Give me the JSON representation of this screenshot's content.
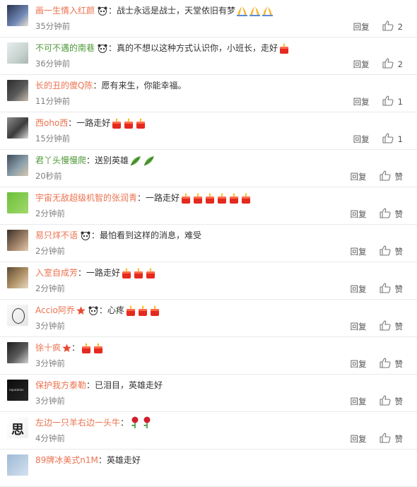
{
  "comments": [
    {
      "user": "画一生情入红颜",
      "text": "：战士永远是战士，天堂依旧有梦",
      "emoji": [
        "pray",
        "pray",
        "pray"
      ],
      "time": "35分钟前",
      "reply": "回复",
      "likes": "2",
      "panda": true
    },
    {
      "user": "不可不遇的南巷",
      "text": "：真的不想以这种方式认识你，小班长，走好",
      "emoji": [
        "candle"
      ],
      "time": "36分钟前",
      "reply": "回复",
      "likes": "2",
      "panda": true
    },
    {
      "user": "长的丑的傻Q陈",
      "text": "：愿有来生，你能幸福。",
      "emoji": [],
      "time": "11分钟前",
      "reply": "回复",
      "likes": "1",
      "panda": false
    },
    {
      "user": "西oho西",
      "text": "：一路走好",
      "emoji": [
        "candle",
        "candle",
        "candle"
      ],
      "time": "15分钟前",
      "reply": "回复",
      "likes": "1",
      "panda": false
    },
    {
      "user": "君丫头慢慢爬",
      "text": "：送别英雄",
      "emoji": [
        "leaf",
        "leaf"
      ],
      "time": "20秒前",
      "reply": "回复",
      "likes": "赞",
      "panda": false
    },
    {
      "user": "宇宙无敌超级机智的张润青",
      "text": "：一路走好",
      "emoji": [
        "candle",
        "candle",
        "candle",
        "candle",
        "candle",
        "candle"
      ],
      "time": "2分钟前",
      "reply": "回复",
      "likes": "赞",
      "panda": false
    },
    {
      "user": "易只烊不语",
      "text": "：最怕看到这样的消息，难受",
      "emoji": [],
      "time": "2分钟前",
      "reply": "回复",
      "likes": "赞",
      "panda": true
    },
    {
      "user": "入室自成芳",
      "text": "：一路走好",
      "emoji": [
        "candle",
        "candle",
        "candle"
      ],
      "time": "2分钟前",
      "reply": "回复",
      "likes": "赞",
      "panda": false
    },
    {
      "user": "Accio阿乔",
      "text": "：心疼",
      "emoji": [
        "candle",
        "candle",
        "candle"
      ],
      "time": "3分钟前",
      "reply": "回复",
      "likes": "赞",
      "panda": true,
      "star": true
    },
    {
      "user": "徐十疯",
      "text": "：",
      "emoji": [
        "candle",
        "candle"
      ],
      "time": "3分钟前",
      "reply": "回复",
      "likes": "赞",
      "panda": false,
      "star": true
    },
    {
      "user": "保护我方泰勒",
      "text": "：已泪目，英雄走好",
      "emoji": [],
      "time": "3分钟前",
      "reply": "回复",
      "likes": "赞",
      "panda": false
    },
    {
      "user": "左边一只羊右边一头牛",
      "text": "：",
      "emoji": [
        "rose",
        "rose"
      ],
      "time": "4分钟前",
      "reply": "回复",
      "likes": "赞",
      "panda": false
    },
    {
      "user": "89牌冰美式n1M",
      "text": "：英雄走好",
      "emoji": [],
      "time": "",
      "reply": "",
      "likes": "",
      "panda": false
    }
  ],
  "colors": {
    "username": "#eb7350",
    "text": "#333333",
    "meta": "#808080",
    "border": "#e9e9e9"
  },
  "icons": {
    "like": "thumbs-up-icon",
    "panda": "panda-badge-icon",
    "star": "star-badge-icon"
  }
}
